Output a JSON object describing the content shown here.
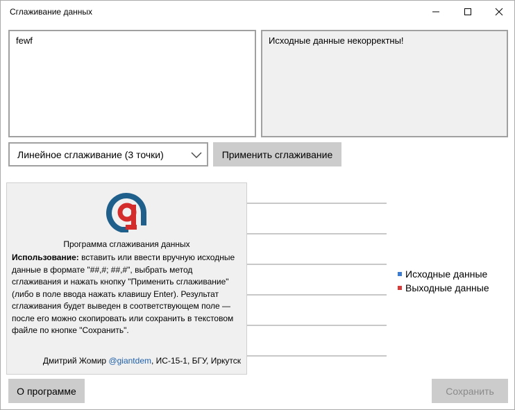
{
  "window": {
    "title": "Сглаживание данных"
  },
  "input_area": {
    "value": "fewf"
  },
  "output_area": {
    "value": "Исходные данные некорректны!"
  },
  "method_select": {
    "selected": "Линейное сглаживание (3 точки)"
  },
  "buttons": {
    "apply_label": "Применить сглаживание",
    "about_label": "О программе",
    "save_label": "Сохранить"
  },
  "legend": {
    "items": [
      {
        "label": "Исходные данные",
        "color": "#3a7bd5"
      },
      {
        "label": "Выходные данные",
        "color": "#d93a3a"
      }
    ]
  },
  "about": {
    "title": "Программа сглаживания данных",
    "usage_heading": "Использование:",
    "usage_text": " вставить или ввести вручную исходные данные в формате \"##,#; ##,#\", выбрать метод сглаживания и нажать кнопку \"Применить сглаживание\" (либо в поле ввода нажать клавишу Enter). Результат сглаживания будет выведен в соответствующем поле — после его можно скопировать или сохранить в текстовом файле по кнопке \"Сохранить\".",
    "author_name": "Дмитрий Жомир ",
    "author_handle": "@giantdem",
    "author_rest": ", ИС-15-1, БГУ, Иркутск",
    "logo_colors": {
      "blue": "#1f5f8b",
      "red": "#d42b2b"
    }
  },
  "colors": {
    "button_bg": "#cccccc",
    "panel_bg": "#f0f0f0",
    "disabled_text": "#8a8a8a"
  }
}
